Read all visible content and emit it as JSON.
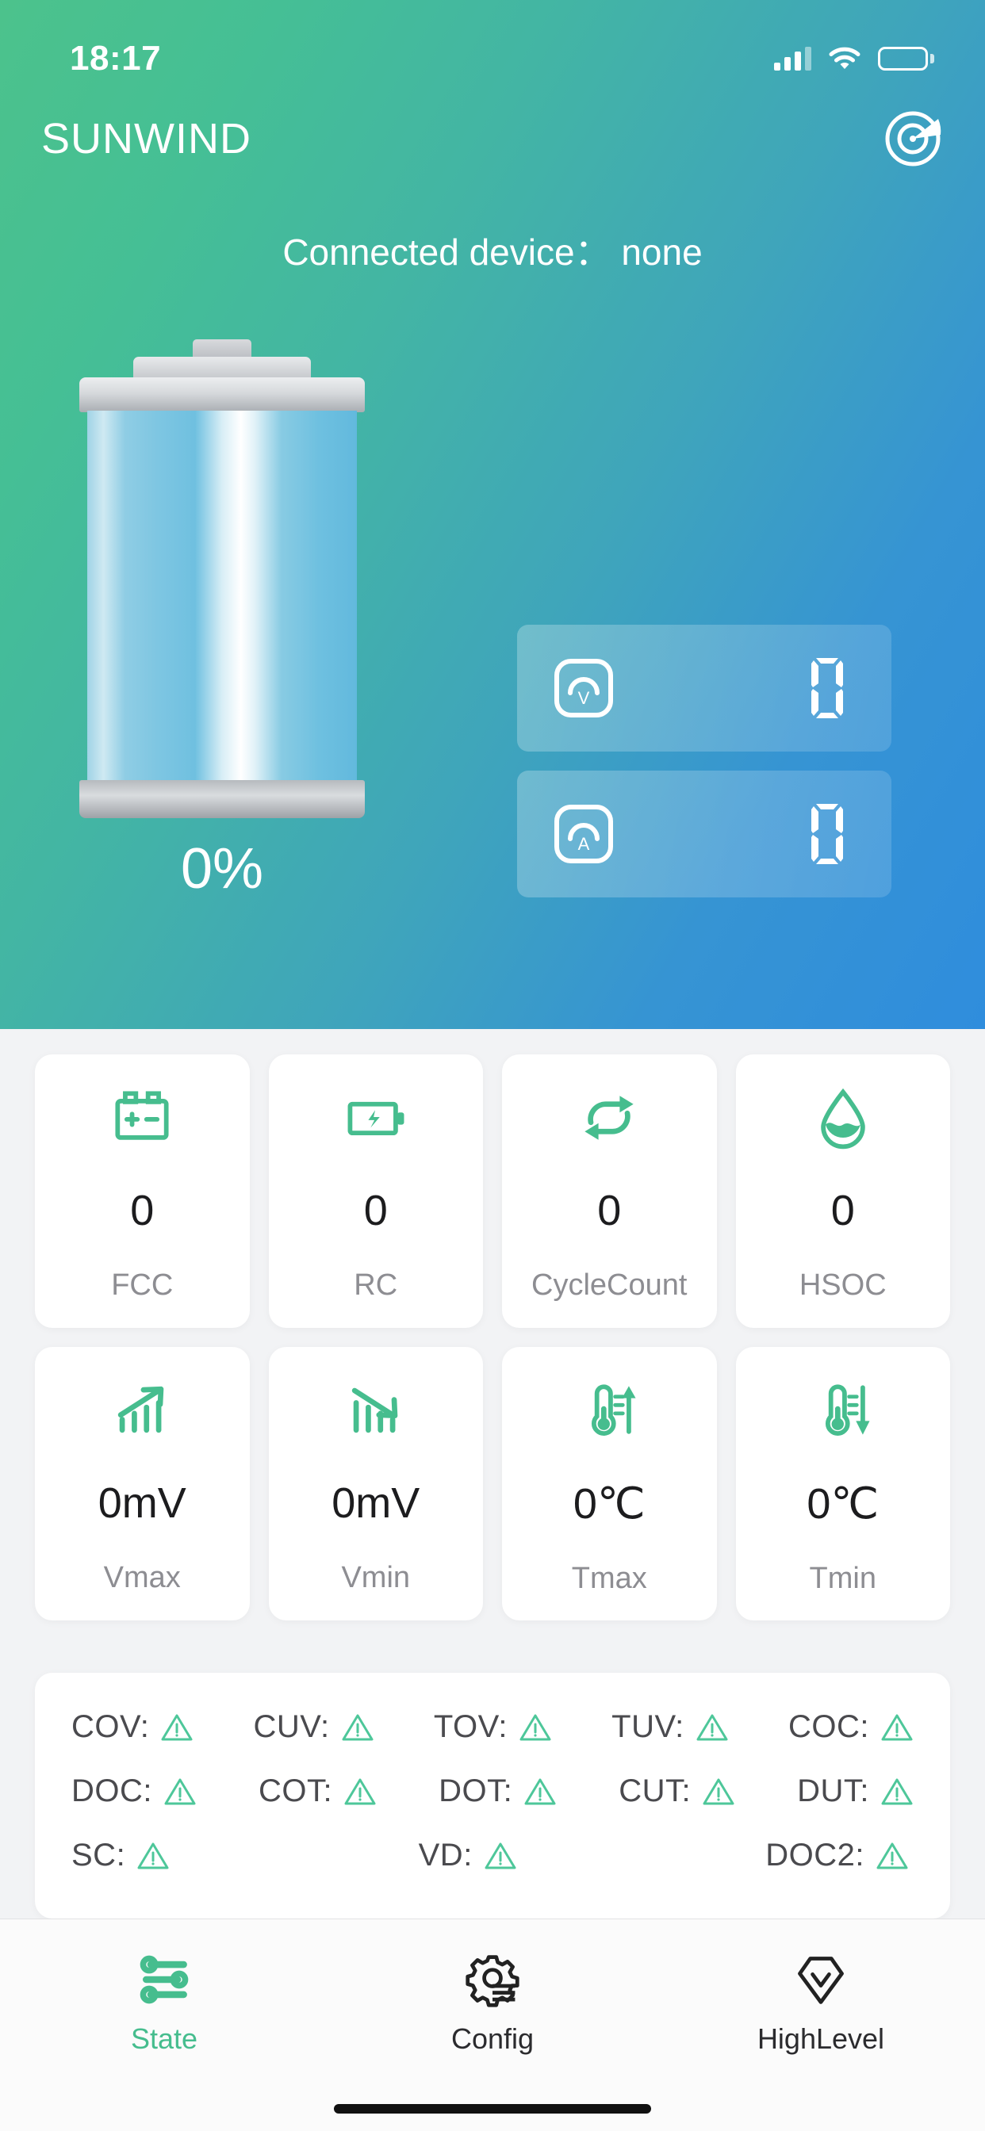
{
  "status_bar": {
    "time": "18:17",
    "signal_icon": "cellular-signal-icon",
    "wifi_icon": "wifi-icon",
    "battery_icon": "battery-icon"
  },
  "header": {
    "app_title": "SUNWIND",
    "scan_icon": "radar-scan-icon"
  },
  "hero": {
    "connected_device_text": "Connected device： none",
    "battery_percent": "0%",
    "battery_icon": "battery-cell-graphic",
    "meters": [
      {
        "icon": "voltmeter-icon",
        "label": "Voltage",
        "value": "0"
      },
      {
        "icon": "ammeter-icon",
        "label": "Current",
        "value": "0"
      }
    ]
  },
  "stats": [
    {
      "icon": "car-battery-icon",
      "value": "0",
      "label": "FCC"
    },
    {
      "icon": "battery-bolt-icon",
      "value": "0",
      "label": "RC"
    },
    {
      "icon": "repeat-cycle-icon",
      "value": "0",
      "label": "CycleCount"
    },
    {
      "icon": "water-droplet-icon",
      "value": "0",
      "label": "HSOC"
    },
    {
      "icon": "bars-up-icon",
      "value": "0mV",
      "label": "Vmax"
    },
    {
      "icon": "bars-down-icon",
      "value": "0mV",
      "label": "Vmin"
    },
    {
      "icon": "thermometer-up-icon",
      "value": "0℃",
      "label": "Tmax"
    },
    {
      "icon": "thermometer-down-icon",
      "value": "0℃",
      "label": "Tmin"
    }
  ],
  "alarms": {
    "warning_icon": "warning-triangle-icon",
    "rows": [
      [
        {
          "label": "COV:"
        },
        {
          "label": "CUV:"
        },
        {
          "label": "TOV:"
        },
        {
          "label": "TUV:"
        },
        {
          "label": "COC:"
        }
      ],
      [
        {
          "label": "DOC:"
        },
        {
          "label": "COT:"
        },
        {
          "label": "DOT:"
        },
        {
          "label": "CUT:"
        },
        {
          "label": "DUT:"
        }
      ],
      [
        {
          "label": "SC:"
        },
        {
          "label": "VD:"
        },
        {
          "label": "DOC2:"
        }
      ]
    ]
  },
  "tabs": [
    {
      "label": "State",
      "icon": "sliders-icon",
      "active": true
    },
    {
      "label": "Config",
      "icon": "gear-list-icon",
      "active": false
    },
    {
      "label": "HighLevel",
      "icon": "diamond-check-icon",
      "active": false
    }
  ],
  "colors": {
    "accent_green": "#46bd8e",
    "hero_gradient_start": "#4cc28c",
    "hero_gradient_end": "#2f8ddd",
    "card_bg": "#ffffff",
    "page_bg": "#f2f3f5",
    "value_text": "#1c1c1e",
    "label_text": "#8d8d92"
  }
}
